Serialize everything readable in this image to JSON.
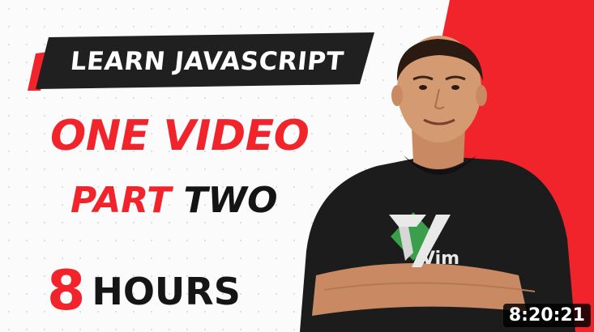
{
  "thumbnail": {
    "banner_title": "LEARN JAVASCRIPT",
    "headline_line1": "ONE VIDEO",
    "headline_line2_word1": "PART",
    "headline_line2_word2": "TWO",
    "duration_number": "8",
    "duration_unit": "HOURS",
    "shirt_logo": "Vim"
  },
  "overlay": {
    "duration_badge": "8:20:21"
  },
  "colors": {
    "accent_red": "#f1242b",
    "banner_dark": "#202020",
    "vim_green": "#3a9e4a"
  }
}
